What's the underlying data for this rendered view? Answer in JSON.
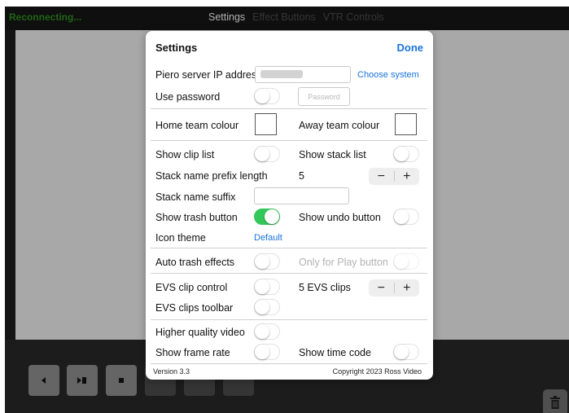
{
  "topbar": {
    "status": "Reconnecting...",
    "tabs": [
      "Settings",
      "Effect Buttons",
      "VTR Controls"
    ]
  },
  "settings": {
    "title": "Settings",
    "done": "Done",
    "ip_label": "Piero server IP address",
    "ip_value_obscured": true,
    "choose_system": "Choose system",
    "use_password": "Use password",
    "password_placeholder": "Password",
    "home_colour": "Home team colour",
    "away_colour": "Away team colour",
    "show_clip_list": "Show clip list",
    "show_stack_list": "Show stack list",
    "prefix_label": "Stack name prefix length",
    "prefix_value": "5",
    "suffix_label": "Stack name suffix",
    "show_trash": "Show trash button",
    "show_undo": "Show undo button",
    "icon_theme": "Icon theme",
    "icon_theme_value": "Default",
    "auto_trash": "Auto trash effects",
    "only_play": "Only for Play button",
    "evs_clip_control": "EVS clip control",
    "evs_clips_count": "5 EVS clips",
    "evs_toolbar": "EVS clips toolbar",
    "higher_quality": "Higher quality video",
    "show_frame_rate": "Show frame rate",
    "show_time_code": "Show time code",
    "version": "Version 3.3",
    "copyright": "Copyright 2023 Ross Video",
    "stepper_minus": "−",
    "stepper_plus": "+"
  },
  "toggles": {
    "use_password": false,
    "show_clip_list": false,
    "show_stack_list": false,
    "show_trash": true,
    "show_undo": false,
    "auto_trash": false,
    "only_play": false,
    "evs_clip_control": false,
    "evs_toolbar": false,
    "higher_quality": false,
    "show_frame_rate": false,
    "show_time_code": false
  },
  "icons": {
    "prev": "step-back-icon",
    "play_pause": "play-pause-icon",
    "stop": "stop-icon",
    "trash": "trash-icon"
  },
  "colors": {
    "accent": "#1a73d9",
    "toggle_on": "#34c759",
    "status": "#2f8a1d"
  }
}
